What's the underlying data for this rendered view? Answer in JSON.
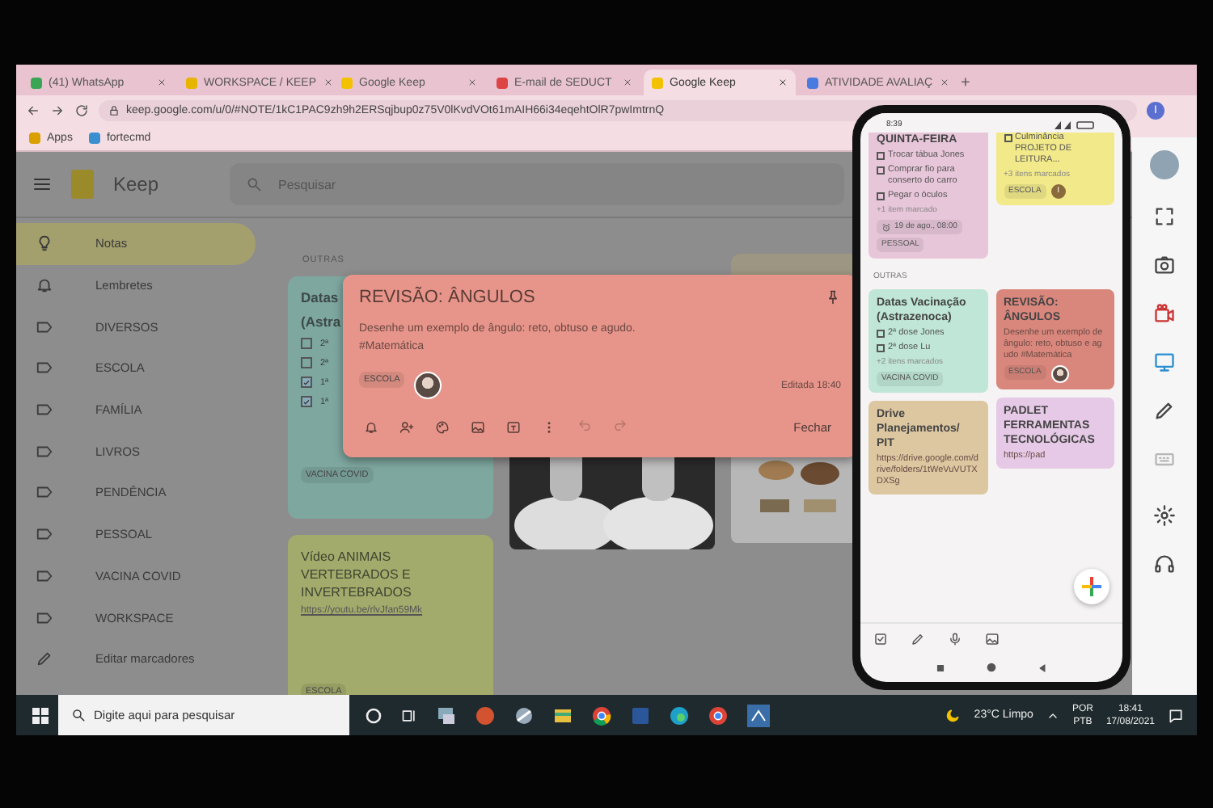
{
  "browser": {
    "tabs": [
      {
        "title": "(41) WhatsApp",
        "selected": false
      },
      {
        "title": "WORKSPACE / KEEP",
        "selected": false
      },
      {
        "title": "Google Keep",
        "selected": false
      },
      {
        "title": "E-mail de SEDUCT",
        "selected": false
      },
      {
        "title": "Google Keep",
        "selected": true
      },
      {
        "title": "ATIVIDADE AVALIAÇ",
        "selected": false
      }
    ],
    "new_tab": "+",
    "url": "keep.google.com/u/0/#NOTE/1kC1PAC9zh9h2ERSqjbup0z75V0lKvdVOt61mAIH66i34eqehtOlR7pwImtrnQ",
    "profile": "I",
    "bookmarks": [
      "Apps",
      "fortecmd"
    ]
  },
  "keep": {
    "app_name": "Keep",
    "search": {
      "placeholder": "Pesquisar"
    },
    "sidebar": [
      {
        "label": "Notas",
        "kind": "notes",
        "selected": true
      },
      {
        "label": "Lembretes",
        "kind": "reminders",
        "selected": false
      },
      {
        "label": "DIVERSOS",
        "kind": "label",
        "selected": false
      },
      {
        "label": "ESCOLA",
        "kind": "label",
        "selected": false
      },
      {
        "label": "FAMÍLIA",
        "kind": "label",
        "selected": false
      },
      {
        "label": "LIVROS",
        "kind": "label",
        "selected": false
      },
      {
        "label": "PENDÊNCIA",
        "kind": "label",
        "selected": false
      },
      {
        "label": "PESSOAL",
        "kind": "label",
        "selected": false
      },
      {
        "label": "VACINA COVID",
        "kind": "label",
        "selected": false
      },
      {
        "label": "WORKSPACE",
        "kind": "label",
        "selected": false
      },
      {
        "label": "Editar marcadores",
        "kind": "edit",
        "selected": false
      }
    ],
    "section": "OUTRAS",
    "vaccine_note": {
      "title": [
        "Datas",
        "(Astra"
      ],
      "items": [
        {
          "text": "2ª",
          "checked": false
        },
        {
          "text": "2ª",
          "checked": false
        },
        {
          "text": "1ª",
          "checked": true
        },
        {
          "text": "1ª",
          "checked": true
        }
      ],
      "label": "VACINA COVID"
    },
    "video_note": {
      "title": "Vídeo ANIMAIS VERTEBRADOS E INVERTEBRADOS",
      "link": "https://youtu.be/rlvJfan59Mk",
      "label": "ESCOLA"
    },
    "open_note": {
      "title": "REVISÃO: ÂNGULOS",
      "body": [
        "Desenhe um exemplo de ângulo: reto, obtuso e agudo.",
        "#Matemática"
      ],
      "label": "ESCOLA",
      "edited": "Editada 18:40",
      "undo": {
        "disabled": true
      },
      "redo": {
        "disabled": true
      },
      "close": "Fechar"
    }
  },
  "phone": {
    "time": "8:39",
    "top_left": {
      "title": "QUINTA-FEIRA",
      "items": [
        {
          "text": "Trocar tábua Jones",
          "checked": false
        },
        {
          "text": "Comprar fio para conserto do carro",
          "checked": false
        },
        {
          "text": "Pegar o óculos",
          "checked": false
        }
      ],
      "more": "+1 item marcado",
      "reminder": "19 de ago., 08:00",
      "label": "PESSOAL"
    },
    "top_right": {
      "items": [
        {
          "text": "Culminância PROJETO DE LEITURA...",
          "checked": false
        }
      ],
      "more": "+3 itens marcados",
      "label": "ESCOLA",
      "avatar": "I"
    },
    "section": "OUTRAS",
    "notes": [
      {
        "title": "Datas Vacinação (Astrazenoca)",
        "items": [
          {
            "text": "2ª dose Jones",
            "checked": false
          },
          {
            "text": "2ª dose Lu",
            "checked": false
          }
        ],
        "more": "+2 itens marcados",
        "label": "VACINA COVID",
        "color": "#bfe6d6"
      },
      {
        "title": "REVISÃO: ÂNGULOS",
        "body": "Desenhe um exemplo de ângulo: reto, obtuso e agudo #Matemática",
        "label": "ESCOLA",
        "color": "#d9877c"
      },
      {
        "title": "Drive Planejamentos/ PIT",
        "body": "https://drive.google.com/drive/folders/1tWeVuVUTXDXSg",
        "color": "#dcc7a0"
      },
      {
        "title": "PADLET FERRAMENTAS TECNOLÓGICAS",
        "body": "https://pad",
        "color": "#e6c9e6"
      }
    ]
  },
  "taskbar": {
    "search": {
      "placeholder": "Digite aqui para pesquisar"
    },
    "weather": "23°C  Limpo",
    "language": [
      "POR",
      "PTB"
    ],
    "time": "18:41",
    "date": "17/08/2021"
  }
}
